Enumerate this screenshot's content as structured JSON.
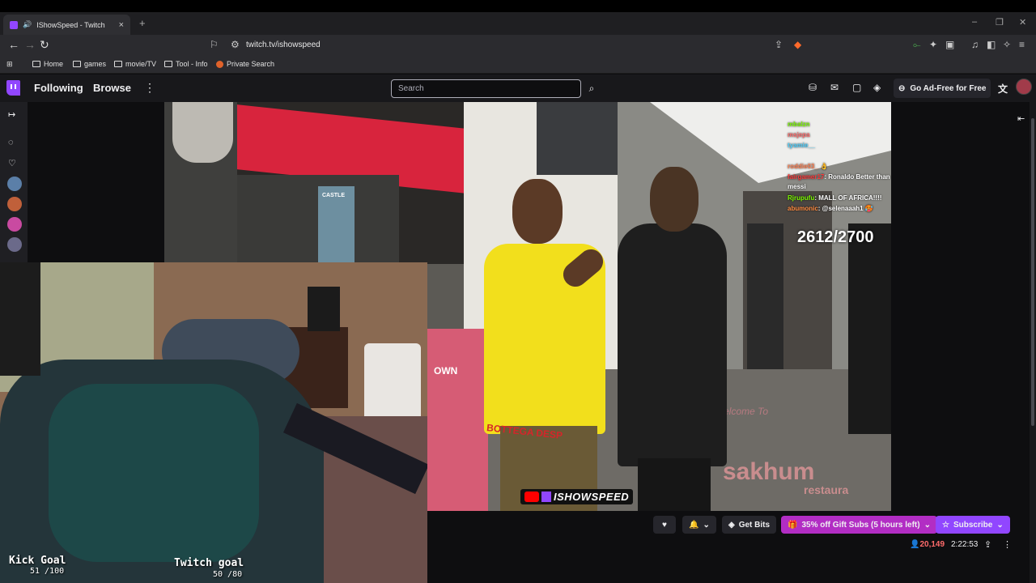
{
  "browser": {
    "tab_title": "IShowSpeed - Twitch",
    "tab_close": "×",
    "new_tab": "+",
    "url": "twitch.tv/ishowspeed",
    "bookmarks": [
      "Home",
      "games",
      "movie/TV",
      "Tool - Info",
      "Private Search"
    ]
  },
  "twitch_nav": {
    "following": "Following",
    "browse": "Browse",
    "more": "⋮",
    "search_placeholder": "Search",
    "ad_free": "Go Ad-Free for Free"
  },
  "stream": {
    "chat": [
      {
        "user": "mbalzn",
        "color": "#7cfc00",
        "msg": ""
      },
      {
        "user": "msjepa",
        "color": "#ff6b6b",
        "msg": ""
      },
      {
        "user": "tyamie__",
        "color": "#4fd1ff",
        "msg": ""
      },
      {
        "user": "roddie03_",
        "color": "#ff7f50",
        "msg": "👌"
      },
      {
        "user": "fairgamer17",
        "color": "#ff3b3b",
        "msg": ": Ronaldo Better than messi"
      },
      {
        "user": "Rjrupufu",
        "color": "#7cfc00",
        "msg": ": MALL OF AFRICA!!!!"
      },
      {
        "user": "abumonic",
        "color": "#ff8c42",
        "msg": ": @selenaaah1 🥵"
      }
    ],
    "gift_count": "2612/2700",
    "brand_name": "ISHOWSPEED",
    "scene_signs": {
      "castle": "CASTLE",
      "restaurant": "sakhum",
      "restaurant2": "restaura",
      "welcome": "Welcome To",
      "shirt": "BOTTEGA DESP",
      "downtown": "OWN"
    }
  },
  "webcam": {
    "kick_title": "Kick Goal",
    "kick_progress": "51 /100",
    "twitch_title": "Twitch goal",
    "twitch_progress": "50 /80"
  },
  "channel_bar": {
    "get_bits": "Get Bits",
    "gift_subs": "35% off Gift Subs (5 hours left)",
    "subscribe": "Subscribe",
    "viewers": "20,149",
    "uptime": "2:22:53"
  },
  "colors": {
    "twitch_purple": "#9146ff",
    "gift_magenta": "#b22dc4",
    "live_red": "#ff6b6b"
  }
}
